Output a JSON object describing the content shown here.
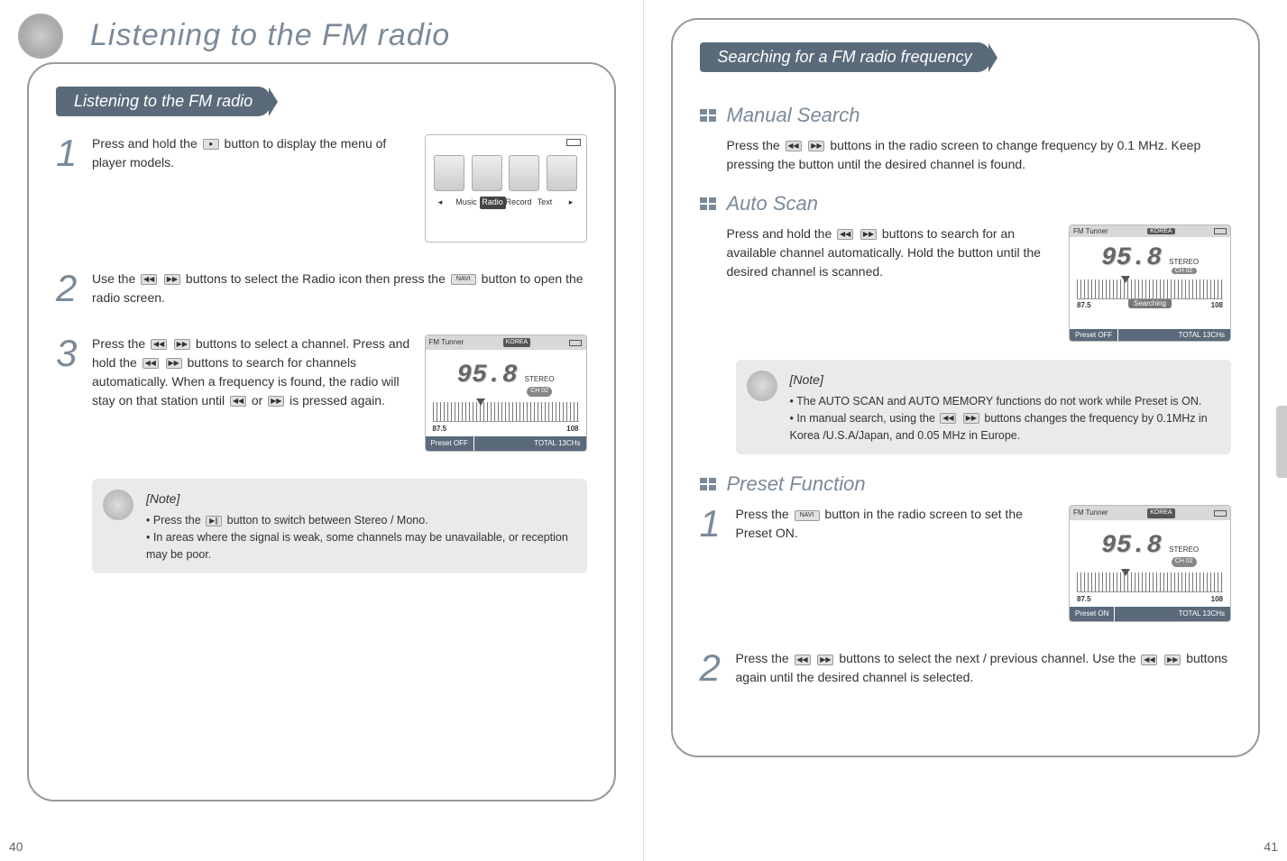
{
  "left": {
    "page_num": "40",
    "main_title": "Listening to the FM radio",
    "section": "Listening to the FM radio",
    "step1": "Press and hold the ",
    "step1b": "button to display the menu of player models.",
    "step2a": "Use the ",
    "step2b": " buttons to select the Radio icon then press the ",
    "step2c": " button to open the radio screen.",
    "step3a": "Press the ",
    "step3b": " buttons to select a channel. Press and hold the ",
    "step3c": " buttons to search for channels automatically. When a frequency is found, the radio will stay on that station until ",
    "step3d": " or ",
    "step3e": " is pressed again.",
    "note_title": "[Note]",
    "note1a": "Press the ",
    "note1b": " button to switch between Stereo / Mono.",
    "note2": "In areas where the signal is weak, some channels may be unavailable, or reception may be poor.",
    "menu_labels": {
      "music": "Music",
      "radio": "Radio",
      "record": "Record",
      "text": "Text"
    }
  },
  "right": {
    "page_num": "41",
    "section": "Searching for a FM radio frequency",
    "manual_h": "Manual Search",
    "manual_a": "Press the ",
    "manual_b": " buttons in the radio screen to change frequency by 0.1 MHz. Keep pressing the button until the desired channel is found.",
    "auto_h": "Auto Scan",
    "auto_a": "Press and hold the ",
    "auto_b": " buttons to search for an available channel automatically. Hold the button until the desired channel is scanned.",
    "note_title": "[Note]",
    "note1": "The AUTO SCAN and AUTO MEMORY functions do not work while Preset is ON.",
    "note2a": "In manual search, using the ",
    "note2b": " buttons changes the frequency by 0.1MHz in Korea /U.S.A/Japan, and 0.05 MHz in Europe.",
    "preset_h": "Preset Function",
    "preset1a": "Press the ",
    "preset1b": " button in the radio screen to set the Preset ON.",
    "preset2a": "Press the ",
    "preset2b": " buttons to select the next / previous channel. Use the ",
    "preset2c": " buttons again until the desired channel is selected."
  },
  "fm": {
    "title": "FM Tunner",
    "region": "KOREA",
    "freq": "95.8",
    "stereo": "STEREO",
    "ch": "CH 02",
    "lo": "87.5",
    "hi": "108",
    "preset_off": "Preset OFF",
    "preset_on": "Preset ON",
    "total": "TOTAL 13CHs",
    "searching": "Searching"
  }
}
